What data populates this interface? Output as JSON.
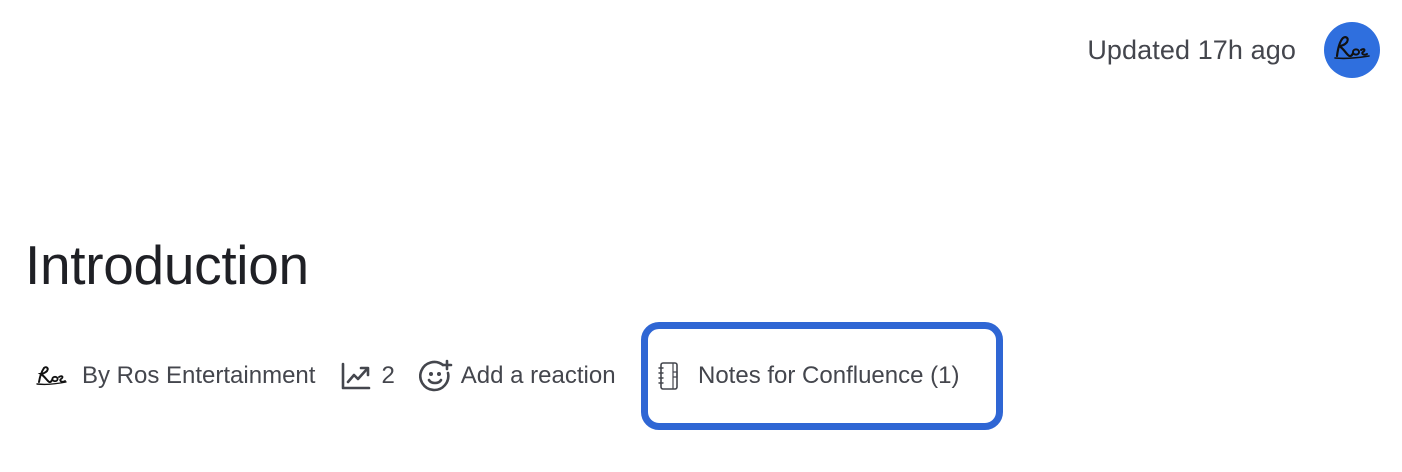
{
  "header": {
    "updated_text": "Updated 17h ago",
    "avatar_icon": "signature-logo-icon",
    "avatar_color": "#2f6fde"
  },
  "page": {
    "title": "Introduction"
  },
  "byline": {
    "author_icon": "signature-logo-icon",
    "author_label": "By Ros Entertainment",
    "views_icon": "analytics-trend-icon",
    "views_count": "2",
    "reaction_icon": "add-reaction-icon",
    "reaction_label": "Add a reaction",
    "notes_icon": "notebook-icon",
    "notes_label": "Notes for Confluence (1)",
    "highlight_color": "#2f66d4"
  }
}
